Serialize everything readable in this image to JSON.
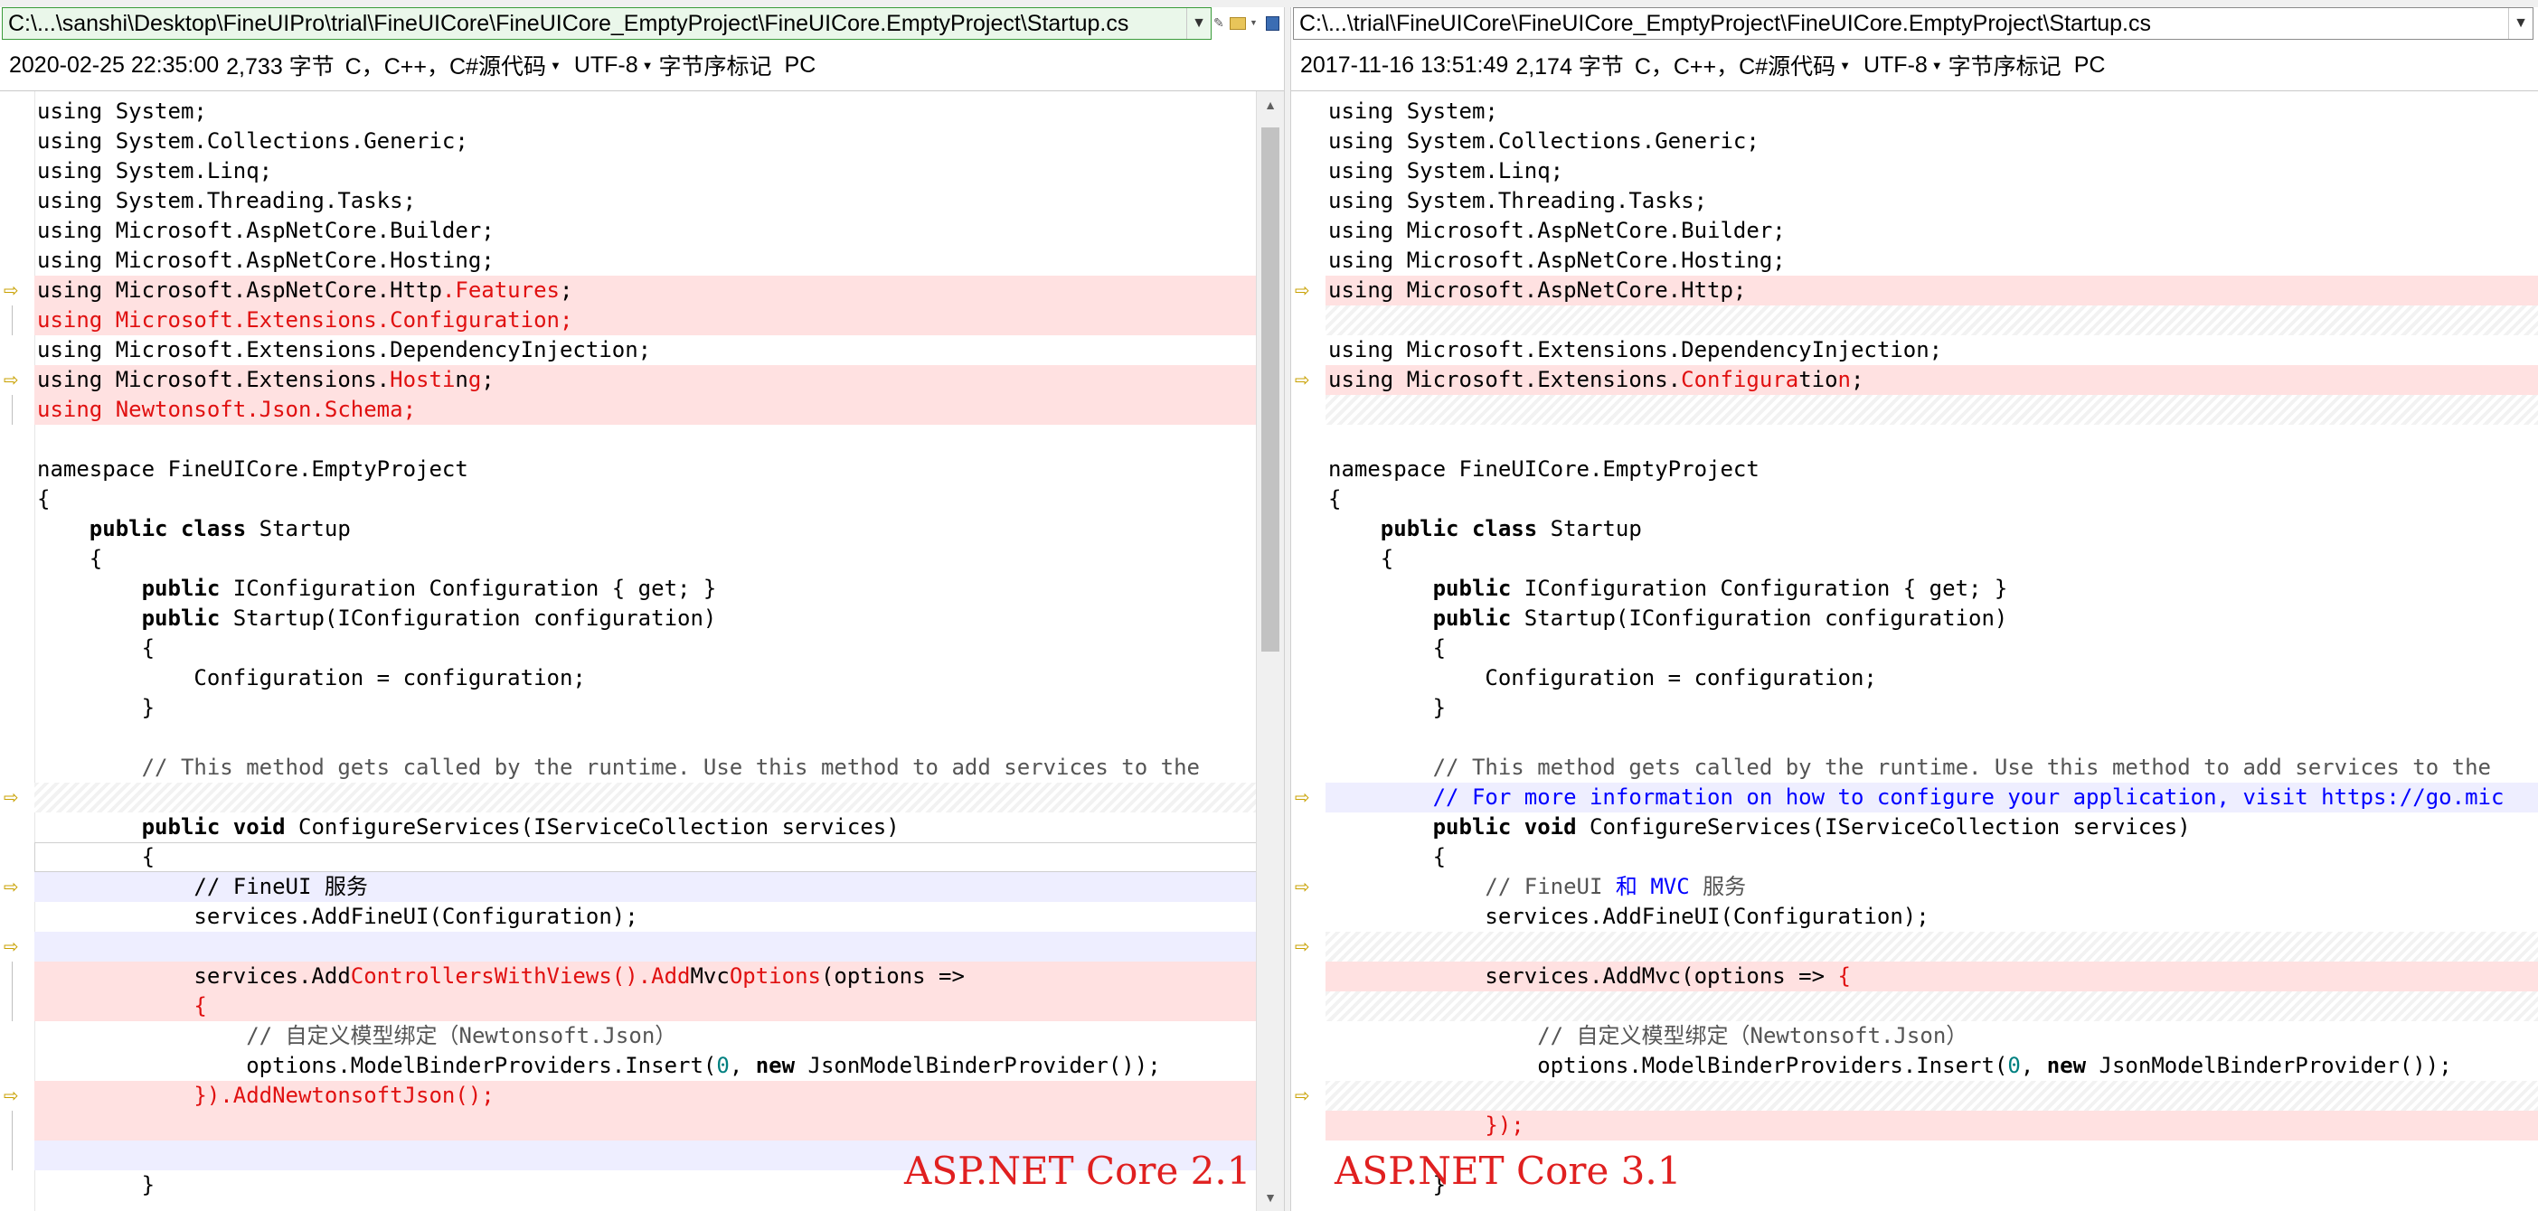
{
  "left": {
    "path": "C:\\...\\sanshi\\Desktop\\FineUIPro\\trial\\FineUICore\\FineUICore_EmptyProject\\FineUICore.EmptyProject\\Startup.cs",
    "info": {
      "datetime": "2020-02-25 22:35:00",
      "size": "2,733 字节",
      "language": "C，C++，C#源代码",
      "encoding": "UTF-8",
      "bom": "字节序标记",
      "eol": "PC"
    },
    "lines": [
      {
        "bg": "",
        "mark": "",
        "segs": [
          {
            "t": "using System;",
            "c": ""
          }
        ]
      },
      {
        "bg": "",
        "mark": "",
        "segs": [
          {
            "t": "using System.Collections.Generic;",
            "c": ""
          }
        ]
      },
      {
        "bg": "",
        "mark": "",
        "segs": [
          {
            "t": "using System.Linq;",
            "c": ""
          }
        ]
      },
      {
        "bg": "",
        "mark": "",
        "segs": [
          {
            "t": "using System.Threading.Tasks;",
            "c": ""
          }
        ]
      },
      {
        "bg": "",
        "mark": "",
        "segs": [
          {
            "t": "using Microsoft.AspNetCore.Builder;",
            "c": ""
          }
        ]
      },
      {
        "bg": "",
        "mark": "",
        "segs": [
          {
            "t": "using Microsoft.AspNetCore.Hosting;",
            "c": ""
          }
        ]
      },
      {
        "bg": "diff",
        "mark": "arrow",
        "segs": [
          {
            "t": "using Microsoft.AspNetCore.Http",
            "c": ""
          },
          {
            "t": ".Features",
            "c": "chg"
          },
          {
            "t": ";",
            "c": ""
          }
        ]
      },
      {
        "bg": "diff",
        "mark": "bar",
        "segs": [
          {
            "t": "using Microsoft.Extensions.Configuration;",
            "c": "chg"
          }
        ]
      },
      {
        "bg": "",
        "mark": "",
        "segs": [
          {
            "t": "using Microsoft.Extensions.DependencyInjection;",
            "c": ""
          }
        ]
      },
      {
        "bg": "diff",
        "mark": "arrow",
        "segs": [
          {
            "t": "using Microsoft.Extensions.",
            "c": ""
          },
          {
            "t": "Hosti",
            "c": "chg"
          },
          {
            "t": "n",
            "c": ""
          },
          {
            "t": "g",
            "c": "chg"
          },
          {
            "t": ";",
            "c": ""
          }
        ]
      },
      {
        "bg": "diff",
        "mark": "bar",
        "segs": [
          {
            "t": "using Newtonsoft.Json.Schema;",
            "c": "chg"
          }
        ]
      },
      {
        "bg": "",
        "mark": "",
        "segs": [
          {
            "t": "",
            "c": ""
          }
        ]
      },
      {
        "bg": "",
        "mark": "",
        "segs": [
          {
            "t": "namespace FineUICore.EmptyProject",
            "c": ""
          }
        ]
      },
      {
        "bg": "",
        "mark": "",
        "segs": [
          {
            "t": "{",
            "c": ""
          }
        ]
      },
      {
        "bg": "",
        "mark": "",
        "segs": [
          {
            "t": "    ",
            "c": ""
          },
          {
            "t": "public class",
            "c": "kw"
          },
          {
            "t": " Startup",
            "c": ""
          }
        ]
      },
      {
        "bg": "",
        "mark": "",
        "segs": [
          {
            "t": "    {",
            "c": ""
          }
        ]
      },
      {
        "bg": "",
        "mark": "",
        "segs": [
          {
            "t": "        ",
            "c": ""
          },
          {
            "t": "public",
            "c": "kw"
          },
          {
            "t": " IConfiguration Configuration { get; }",
            "c": ""
          }
        ]
      },
      {
        "bg": "",
        "mark": "",
        "segs": [
          {
            "t": "        ",
            "c": ""
          },
          {
            "t": "public",
            "c": "kw"
          },
          {
            "t": " Startup(IConfiguration configuration)",
            "c": ""
          }
        ]
      },
      {
        "bg": "",
        "mark": "",
        "segs": [
          {
            "t": "        {",
            "c": ""
          }
        ]
      },
      {
        "bg": "",
        "mark": "",
        "segs": [
          {
            "t": "            Configuration = configuration;",
            "c": ""
          }
        ]
      },
      {
        "bg": "",
        "mark": "",
        "segs": [
          {
            "t": "        }",
            "c": ""
          }
        ]
      },
      {
        "bg": "",
        "mark": "",
        "segs": [
          {
            "t": "",
            "c": ""
          }
        ]
      },
      {
        "bg": "",
        "mark": "",
        "segs": [
          {
            "t": "        // This method gets called by the runtime. Use this method to add services to the",
            "c": "com2"
          }
        ]
      },
      {
        "bg": "gap",
        "mark": "arrow",
        "segs": [
          {
            "t": "",
            "c": ""
          }
        ]
      },
      {
        "bg": "",
        "mark": "",
        "segs": [
          {
            "t": "        ",
            "c": ""
          },
          {
            "t": "public void",
            "c": "kw"
          },
          {
            "t": " ConfigureServices(IServiceCollection services)",
            "c": ""
          }
        ]
      },
      {
        "bg": "cursor",
        "mark": "",
        "segs": [
          {
            "t": "        {",
            "c": ""
          }
        ]
      },
      {
        "bg": "add",
        "mark": "arrow",
        "segs": [
          {
            "t": "            // FineUI 服务",
            "c": ""
          }
        ]
      },
      {
        "bg": "",
        "mark": "",
        "segs": [
          {
            "t": "            services.AddFineUI(Configuration);",
            "c": ""
          }
        ]
      },
      {
        "bg": "add",
        "mark": "arrow",
        "segs": [
          {
            "t": "",
            "c": ""
          }
        ]
      },
      {
        "bg": "diff",
        "mark": "bar",
        "segs": [
          {
            "t": "            services.Add",
            "c": ""
          },
          {
            "t": "ControllersWithViews().Add",
            "c": "chg"
          },
          {
            "t": "Mvc",
            "c": ""
          },
          {
            "t": "Options",
            "c": "chg"
          },
          {
            "t": "(options =>",
            "c": ""
          }
        ]
      },
      {
        "bg": "diff",
        "mark": "bar",
        "segs": [
          {
            "t": "            {",
            "c": "chg"
          }
        ]
      },
      {
        "bg": "",
        "mark": "",
        "segs": [
          {
            "t": "                // 自定义模型绑定（Newtonsoft.Json）",
            "c": "com2"
          }
        ]
      },
      {
        "bg": "",
        "mark": "",
        "segs": [
          {
            "t": "                options.ModelBinderProviders.Insert(",
            "c": ""
          },
          {
            "t": "0",
            "c": "num"
          },
          {
            "t": ", ",
            "c": ""
          },
          {
            "t": "new",
            "c": "kw"
          },
          {
            "t": " JsonModelBinderProvider());",
            "c": ""
          }
        ]
      },
      {
        "bg": "diff",
        "mark": "arrow",
        "segs": [
          {
            "t": "            }).AddNewtonsoftJson();",
            "c": "chg"
          }
        ]
      },
      {
        "bg": "diff",
        "mark": "bar",
        "segs": [
          {
            "t": "",
            "c": ""
          }
        ]
      },
      {
        "bg": "add",
        "mark": "bar",
        "segs": [
          {
            "t": "",
            "c": ""
          }
        ]
      },
      {
        "bg": "",
        "mark": "",
        "segs": [
          {
            "t": "        }",
            "c": ""
          }
        ]
      }
    ]
  },
  "right": {
    "path": "C:\\...\\trial\\FineUICore\\FineUICore_EmptyProject\\FineUICore.EmptyProject\\Startup.cs",
    "info": {
      "datetime": "2017-11-16 13:51:49",
      "size": "2,174 字节",
      "language": "C，C++，C#源代码",
      "encoding": "UTF-8",
      "bom": "字节序标记",
      "eol": "PC"
    },
    "lines": [
      {
        "bg": "",
        "mark": "",
        "segs": [
          {
            "t": "using System;",
            "c": ""
          }
        ]
      },
      {
        "bg": "",
        "mark": "",
        "segs": [
          {
            "t": "using System.Collections.Generic;",
            "c": ""
          }
        ]
      },
      {
        "bg": "",
        "mark": "",
        "segs": [
          {
            "t": "using System.Linq;",
            "c": ""
          }
        ]
      },
      {
        "bg": "",
        "mark": "",
        "segs": [
          {
            "t": "using System.Threading.Tasks;",
            "c": ""
          }
        ]
      },
      {
        "bg": "",
        "mark": "",
        "segs": [
          {
            "t": "using Microsoft.AspNetCore.Builder;",
            "c": ""
          }
        ]
      },
      {
        "bg": "",
        "mark": "",
        "segs": [
          {
            "t": "using Microsoft.AspNetCore.Hosting;",
            "c": ""
          }
        ]
      },
      {
        "bg": "diff",
        "mark": "arrow",
        "segs": [
          {
            "t": "using Microsoft.AspNetCore.Http;",
            "c": ""
          }
        ]
      },
      {
        "bg": "gap",
        "mark": "",
        "segs": [
          {
            "t": "",
            "c": ""
          }
        ]
      },
      {
        "bg": "",
        "mark": "",
        "segs": [
          {
            "t": "using Microsoft.Extensions.DependencyInjection;",
            "c": ""
          }
        ]
      },
      {
        "bg": "diff",
        "mark": "arrow",
        "segs": [
          {
            "t": "using Microsoft.Extensions.",
            "c": ""
          },
          {
            "t": "Configura",
            "c": "chg"
          },
          {
            "t": "tio",
            "c": ""
          },
          {
            "t": "n",
            "c": "chg"
          },
          {
            "t": ";",
            "c": ""
          }
        ]
      },
      {
        "bg": "gap",
        "mark": "",
        "segs": [
          {
            "t": "",
            "c": ""
          }
        ]
      },
      {
        "bg": "",
        "mark": "",
        "segs": [
          {
            "t": "",
            "c": ""
          }
        ]
      },
      {
        "bg": "",
        "mark": "",
        "segs": [
          {
            "t": "namespace FineUICore.EmptyProject",
            "c": ""
          }
        ]
      },
      {
        "bg": "",
        "mark": "",
        "segs": [
          {
            "t": "{",
            "c": ""
          }
        ]
      },
      {
        "bg": "",
        "mark": "",
        "segs": [
          {
            "t": "    ",
            "c": ""
          },
          {
            "t": "public class",
            "c": "kw"
          },
          {
            "t": " Startup",
            "c": ""
          }
        ]
      },
      {
        "bg": "",
        "mark": "",
        "segs": [
          {
            "t": "    {",
            "c": ""
          }
        ]
      },
      {
        "bg": "",
        "mark": "",
        "segs": [
          {
            "t": "        ",
            "c": ""
          },
          {
            "t": "public",
            "c": "kw"
          },
          {
            "t": " IConfiguration Configuration { get; }",
            "c": ""
          }
        ]
      },
      {
        "bg": "",
        "mark": "",
        "segs": [
          {
            "t": "        ",
            "c": ""
          },
          {
            "t": "public",
            "c": "kw"
          },
          {
            "t": " Startup(IConfiguration configuration)",
            "c": ""
          }
        ]
      },
      {
        "bg": "",
        "mark": "",
        "segs": [
          {
            "t": "        {",
            "c": ""
          }
        ]
      },
      {
        "bg": "",
        "mark": "",
        "segs": [
          {
            "t": "            Configuration = configuration;",
            "c": ""
          }
        ]
      },
      {
        "bg": "",
        "mark": "",
        "segs": [
          {
            "t": "        }",
            "c": ""
          }
        ]
      },
      {
        "bg": "",
        "mark": "",
        "segs": [
          {
            "t": "",
            "c": ""
          }
        ]
      },
      {
        "bg": "",
        "mark": "",
        "segs": [
          {
            "t": "        // This method gets called by the runtime. Use this method to add services to the",
            "c": "com2"
          }
        ]
      },
      {
        "bg": "add",
        "mark": "arrow",
        "segs": [
          {
            "t": "        // For more information on how to configure your application, visit https://go.mic",
            "c": "com"
          }
        ]
      },
      {
        "bg": "",
        "mark": "",
        "segs": [
          {
            "t": "        ",
            "c": ""
          },
          {
            "t": "public void",
            "c": "kw"
          },
          {
            "t": " ConfigureServices(IServiceCollection services)",
            "c": ""
          }
        ]
      },
      {
        "bg": "",
        "mark": "",
        "segs": [
          {
            "t": "        {",
            "c": ""
          }
        ]
      },
      {
        "bg": "",
        "mark": "arrow",
        "segs": [
          {
            "t": "            // FineUI ",
            "c": "com2"
          },
          {
            "t": "和 MVC",
            "c": "com"
          },
          {
            "t": " 服务",
            "c": "com2"
          }
        ]
      },
      {
        "bg": "",
        "mark": "",
        "segs": [
          {
            "t": "            services.AddFineUI(Configuration);",
            "c": ""
          }
        ]
      },
      {
        "bg": "gap",
        "mark": "arrow",
        "segs": [
          {
            "t": "",
            "c": ""
          }
        ]
      },
      {
        "bg": "diff",
        "mark": "",
        "segs": [
          {
            "t": "            services.AddMvc(options => ",
            "c": ""
          },
          {
            "t": "{",
            "c": "chg"
          }
        ]
      },
      {
        "bg": "gap",
        "mark": "",
        "segs": [
          {
            "t": "",
            "c": ""
          }
        ]
      },
      {
        "bg": "",
        "mark": "",
        "segs": [
          {
            "t": "                // 自定义模型绑定（Newtonsoft.Json）",
            "c": "com2"
          }
        ]
      },
      {
        "bg": "",
        "mark": "",
        "segs": [
          {
            "t": "                options.ModelBinderProviders.Insert(",
            "c": ""
          },
          {
            "t": "0",
            "c": "num"
          },
          {
            "t": ", ",
            "c": ""
          },
          {
            "t": "new",
            "c": "kw"
          },
          {
            "t": " JsonModelBinderProvider());",
            "c": ""
          }
        ]
      },
      {
        "bg": "gap",
        "mark": "arrow",
        "segs": [
          {
            "t": "",
            "c": ""
          }
        ]
      },
      {
        "bg": "diff",
        "mark": "",
        "segs": [
          {
            "t": "            });",
            "c": "chg"
          }
        ]
      },
      {
        "bg": "",
        "mark": "",
        "segs": [
          {
            "t": "",
            "c": ""
          }
        ]
      },
      {
        "bg": "",
        "mark": "",
        "segs": [
          {
            "t": "        }",
            "c": ""
          }
        ]
      }
    ]
  },
  "overlays": {
    "left_label": "ASP.NET Core 2.1",
    "right_label": "ASP.NET Core 3.1"
  },
  "colors": {
    "diff_bg": "#ffe1e1",
    "add_bg": "#eeeeff",
    "changed_text": "#e01010",
    "comment_blue": "#0000ff",
    "overlay_red": "#e02020"
  },
  "icons": {
    "diff_marker": "arrow-right-icon",
    "dropdown": "chevron-down-icon",
    "open_folder": "folder-icon",
    "save": "disk-icon"
  }
}
